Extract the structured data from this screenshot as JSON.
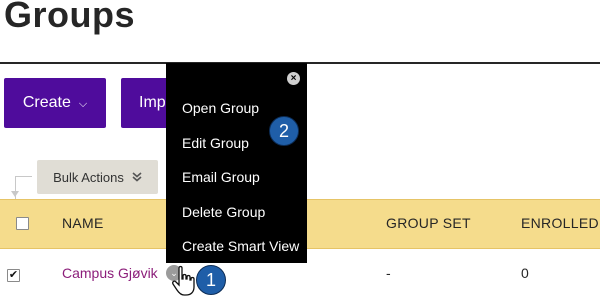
{
  "page": {
    "title": "Groups"
  },
  "toolbar": {
    "create_label": "Create",
    "import_label": "Imp"
  },
  "bulk": {
    "label": "Bulk Actions"
  },
  "table": {
    "columns": {
      "name": "NAME",
      "group_set": "GROUP SET",
      "enrolled": "ENROLLED I"
    },
    "rows": [
      {
        "name": "Campus Gjøvik",
        "group_set": "-",
        "enrolled": "0",
        "checked": true
      }
    ]
  },
  "context_menu": {
    "items": [
      "Open Group",
      "Edit Group",
      "Email Group",
      "Delete Group",
      "Create Smart View"
    ]
  },
  "callouts": [
    "1",
    "2"
  ],
  "colors": {
    "accent_purple": "#4f0c9c",
    "header_yellow": "#f5dc8c",
    "link_purple": "#8c1e7a",
    "callout_blue": "#1f5ea8"
  },
  "icons": {
    "create_dropdown": "chevron-down-icon",
    "bulk_dropdown": "double-chevron-down-icon",
    "menu_close": "close-icon",
    "row_options": "chevron-down-circle-icon",
    "pointer": "hand-cursor-icon"
  }
}
